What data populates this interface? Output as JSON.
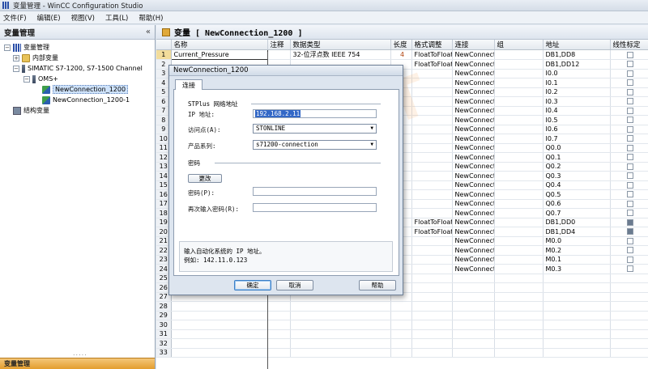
{
  "window": {
    "title": "变量管理 - WinCC Configuration Studio"
  },
  "menu": [
    "文件(F)",
    "编辑(E)",
    "视图(V)",
    "工具(L)",
    "帮助(H)"
  ],
  "left_panel": {
    "title": "变量管理",
    "collapse_glyph": "«",
    "tree": {
      "root": "变量管理",
      "internal": "内部变量",
      "channel": "SIMATIC S7-1200, S7-1500 Channel",
      "oms": "OMS+",
      "conn1": "NewConnection_1200",
      "conn2": "NewConnection_1200-1",
      "struct": "结构变量"
    },
    "bottom_tab": "变量管理"
  },
  "main": {
    "header": "变量 [ NewConnection_1200 ]",
    "columns": [
      "名称",
      "注释",
      "数据类型",
      "长度",
      "格式调整",
      "连接",
      "组",
      "地址",
      "线性标定"
    ],
    "rows": [
      {
        "n": "1",
        "name": "Current_Pressure",
        "comment": "",
        "type": "32-位浮点数 IEEE 754",
        "len": "4",
        "fmt": "FloatToFloat",
        "conn": "NewConnectio",
        "addr": "DB1,DD8",
        "chk": false
      },
      {
        "n": "2",
        "name": "",
        "comment": "",
        "type": "",
        "len": "",
        "fmt": "FloatToFloat",
        "conn": "NewConnectio",
        "addr": "DB1,DD12",
        "chk": false
      },
      {
        "n": "3",
        "name": "",
        "comment": "",
        "type": "",
        "len": "",
        "fmt": "",
        "conn": "NewConnectio",
        "addr": "I0.0",
        "chk": false
      },
      {
        "n": "4",
        "name": "",
        "comment": "",
        "type": "",
        "len": "",
        "fmt": "",
        "conn": "NewConnectio",
        "addr": "I0.1",
        "chk": false
      },
      {
        "n": "5",
        "name": "",
        "comment": "",
        "type": "",
        "len": "",
        "fmt": "",
        "conn": "NewConnectio",
        "addr": "I0.2",
        "chk": false
      },
      {
        "n": "6",
        "name": "",
        "comment": "",
        "type": "",
        "len": "",
        "fmt": "",
        "conn": "NewConnectio",
        "addr": "I0.3",
        "chk": false
      },
      {
        "n": "7",
        "name": "",
        "comment": "",
        "type": "",
        "len": "",
        "fmt": "",
        "conn": "NewConnectio",
        "addr": "I0.4",
        "chk": false
      },
      {
        "n": "8",
        "name": "",
        "comment": "",
        "type": "",
        "len": "",
        "fmt": "",
        "conn": "NewConnectio",
        "addr": "I0.5",
        "chk": false
      },
      {
        "n": "9",
        "name": "",
        "comment": "",
        "type": "",
        "len": "",
        "fmt": "",
        "conn": "NewConnectio",
        "addr": "I0.6",
        "chk": false
      },
      {
        "n": "10",
        "name": "",
        "comment": "",
        "type": "",
        "len": "",
        "fmt": "",
        "conn": "NewConnectio",
        "addr": "I0.7",
        "chk": false
      },
      {
        "n": "11",
        "name": "",
        "comment": "",
        "type": "",
        "len": "",
        "fmt": "",
        "conn": "NewConnectio",
        "addr": "Q0.0",
        "chk": false
      },
      {
        "n": "12",
        "name": "",
        "comment": "",
        "type": "",
        "len": "",
        "fmt": "",
        "conn": "NewConnectio",
        "addr": "Q0.1",
        "chk": false
      },
      {
        "n": "13",
        "name": "",
        "comment": "",
        "type": "",
        "len": "",
        "fmt": "",
        "conn": "NewConnectio",
        "addr": "Q0.2",
        "chk": false
      },
      {
        "n": "14",
        "name": "",
        "comment": "",
        "type": "",
        "len": "",
        "fmt": "",
        "conn": "NewConnectio",
        "addr": "Q0.3",
        "chk": false
      },
      {
        "n": "15",
        "name": "",
        "comment": "",
        "type": "",
        "len": "",
        "fmt": "",
        "conn": "NewConnectio",
        "addr": "Q0.4",
        "chk": false
      },
      {
        "n": "16",
        "name": "",
        "comment": "",
        "type": "",
        "len": "",
        "fmt": "",
        "conn": "NewConnectio",
        "addr": "Q0.5",
        "chk": false
      },
      {
        "n": "17",
        "name": "",
        "comment": "",
        "type": "",
        "len": "",
        "fmt": "",
        "conn": "NewConnectio",
        "addr": "Q0.6",
        "chk": false
      },
      {
        "n": "18",
        "name": "",
        "comment": "",
        "type": "",
        "len": "",
        "fmt": "",
        "conn": "NewConnectio",
        "addr": "Q0.7",
        "chk": false
      },
      {
        "n": "19",
        "name": "",
        "comment": "",
        "type": "",
        "len": "",
        "fmt": "FloatToFloat",
        "conn": "NewConnectio",
        "addr": "DB1,DD0",
        "chk": true
      },
      {
        "n": "20",
        "name": "",
        "comment": "",
        "type": "",
        "len": "",
        "fmt": "FloatToFloat",
        "conn": "NewConnectio",
        "addr": "DB1,DD4",
        "chk": true
      },
      {
        "n": "21",
        "name": "",
        "comment": "",
        "type": "",
        "len": "",
        "fmt": "",
        "conn": "NewConnectio",
        "addr": "M0.0",
        "chk": false
      },
      {
        "n": "22",
        "name": "",
        "comment": "",
        "type": "",
        "len": "",
        "fmt": "",
        "conn": "NewConnectio",
        "addr": "M0.2",
        "chk": false
      },
      {
        "n": "23",
        "name": "",
        "comment": "",
        "type": "",
        "len": "",
        "fmt": "",
        "conn": "NewConnectio",
        "addr": "M0.1",
        "chk": false
      },
      {
        "n": "24",
        "name": "",
        "comment": "",
        "type": "",
        "len": "",
        "fmt": "",
        "conn": "NewConnectio",
        "addr": "M0.3",
        "chk": false
      },
      {
        "n": "25",
        "name": "",
        "comment": "",
        "type": "",
        "len": "",
        "fmt": "",
        "conn": "",
        "addr": "",
        "chk": null
      },
      {
        "n": "26",
        "name": "",
        "comment": "",
        "type": "",
        "len": "",
        "fmt": "",
        "conn": "",
        "addr": "",
        "chk": null
      },
      {
        "n": "27",
        "name": "",
        "comment": "",
        "type": "",
        "len": "",
        "fmt": "",
        "conn": "",
        "addr": "",
        "chk": null
      },
      {
        "n": "28",
        "name": "",
        "comment": "",
        "type": "",
        "len": "",
        "fmt": "",
        "conn": "",
        "addr": "",
        "chk": null
      },
      {
        "n": "29",
        "name": "",
        "comment": "",
        "type": "",
        "len": "",
        "fmt": "",
        "conn": "",
        "addr": "",
        "chk": null
      },
      {
        "n": "30",
        "name": "",
        "comment": "",
        "type": "",
        "len": "",
        "fmt": "",
        "conn": "",
        "addr": "",
        "chk": null
      },
      {
        "n": "31",
        "name": "",
        "comment": "",
        "type": "",
        "len": "",
        "fmt": "",
        "conn": "",
        "addr": "",
        "chk": null
      },
      {
        "n": "32",
        "name": "",
        "comment": "",
        "type": "",
        "len": "",
        "fmt": "",
        "conn": "",
        "addr": "",
        "chk": null
      },
      {
        "n": "33",
        "name": "",
        "comment": "",
        "type": "",
        "len": "",
        "fmt": "",
        "conn": "",
        "addr": "",
        "chk": null
      }
    ]
  },
  "dialog": {
    "title": "NewConnection_1200",
    "tab": "连接",
    "section_network": "STPlus 网络地址",
    "ip_label": "IP 地址:",
    "ip_value": "192.168.2.11",
    "access_label": "访问点(A):",
    "access_value": "STONLINE",
    "product_label": "产品系列:",
    "product_value": "s71200-connection",
    "section_password": "密码",
    "change_button": "更改",
    "password_label": "密码(P):",
    "password_value": "",
    "confirm_label": "再次输入密码(R):",
    "confirm_value": "",
    "hint_line1": "输入自动化系统的 IP 地址。",
    "hint_line2": "例如: 142.11.0.123",
    "ok": "确定",
    "cancel": "取消",
    "help": "帮助"
  },
  "watermark": "DATAT"
}
